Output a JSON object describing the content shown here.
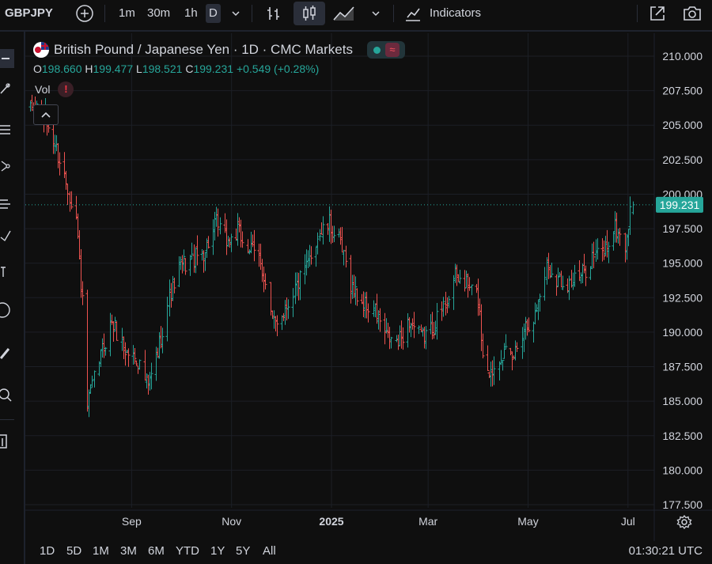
{
  "toolbar": {
    "symbol": "GBPJPY",
    "intervals": [
      "1m",
      "30m",
      "1h",
      "D"
    ],
    "active_interval": "D",
    "indicators_label": "Indicators"
  },
  "legend": {
    "title": "British Pound / Japanese Yen · 1D · CMC Markets",
    "o_label": "O",
    "o_value": "198.660",
    "h_label": "H",
    "h_value": "199.477",
    "l_label": "L",
    "l_value": "198.521",
    "c_label": "C",
    "c_value": "199.231",
    "change": "+0.549 (+0.28%)",
    "vol_label": "Vol",
    "vol_warning": "!"
  },
  "price_axis": {
    "ticks": [
      "210.000",
      "207.500",
      "205.000",
      "202.500",
      "200.000",
      "197.500",
      "195.000",
      "192.500",
      "190.000",
      "187.500",
      "185.000",
      "182.500",
      "180.000",
      "177.500"
    ],
    "last_price": "199.231"
  },
  "time_axis": {
    "labels": [
      "Sep",
      "Nov",
      "2025",
      "Mar",
      "May",
      "Jul"
    ]
  },
  "range_buttons": [
    "1D",
    "5D",
    "1M",
    "3M",
    "6M",
    "YTD",
    "1Y",
    "5Y",
    "All"
  ],
  "clock": "01:30:21 UTC",
  "colors": {
    "up": "#26a69a",
    "down": "#ef5350",
    "background": "#0f0f0f",
    "grid": "#1c1f26",
    "text": "#d1d4dc"
  },
  "chart_data": {
    "type": "ohlc",
    "x_range": [
      "2024-07-01",
      "2025-07-04"
    ],
    "y_range": [
      177.5,
      210.0
    ],
    "y_scale": "linear",
    "grid": true,
    "last_price": 199.231,
    "last_bar": {
      "open": 198.66,
      "high": 199.477,
      "low": 198.521,
      "close": 199.231
    },
    "close_path": [
      {
        "date": "2024-07-01",
        "close": 206.0
      },
      {
        "date": "2024-07-05",
        "close": 206.4
      },
      {
        "date": "2024-07-11",
        "close": 205.2
      },
      {
        "date": "2024-07-16",
        "close": 203.6
      },
      {
        "date": "2024-07-22",
        "close": 201.3
      },
      {
        "date": "2024-07-29",
        "close": 198.3
      },
      {
        "date": "2024-08-02",
        "close": 192.0
      },
      {
        "date": "2024-08-05",
        "close": 184.5
      },
      {
        "date": "2024-08-12",
        "close": 188.0
      },
      {
        "date": "2024-08-20",
        "close": 190.8
      },
      {
        "date": "2024-08-28",
        "close": 188.6
      },
      {
        "date": "2024-09-04",
        "close": 188.2
      },
      {
        "date": "2024-09-11",
        "close": 186.0
      },
      {
        "date": "2024-09-17",
        "close": 188.5
      },
      {
        "date": "2024-09-24",
        "close": 192.6
      },
      {
        "date": "2024-10-01",
        "close": 194.8
      },
      {
        "date": "2024-10-08",
        "close": 195.2
      },
      {
        "date": "2024-10-15",
        "close": 195.8
      },
      {
        "date": "2024-10-23",
        "close": 197.8
      },
      {
        "date": "2024-10-30",
        "close": 196.5
      },
      {
        "date": "2024-11-05",
        "close": 197.2
      },
      {
        "date": "2024-11-12",
        "close": 196.0
      },
      {
        "date": "2024-11-19",
        "close": 195.3
      },
      {
        "date": "2024-11-26",
        "close": 190.6
      },
      {
        "date": "2024-12-03",
        "close": 191.5
      },
      {
        "date": "2024-12-10",
        "close": 193.2
      },
      {
        "date": "2024-12-17",
        "close": 194.6
      },
      {
        "date": "2024-12-24",
        "close": 197.0
      },
      {
        "date": "2024-12-31",
        "close": 197.8
      },
      {
        "date": "2025-01-07",
        "close": 196.2
      },
      {
        "date": "2025-01-14",
        "close": 193.2
      },
      {
        "date": "2025-01-21",
        "close": 192.0
      },
      {
        "date": "2025-01-28",
        "close": 191.5
      },
      {
        "date": "2025-02-04",
        "close": 189.6
      },
      {
        "date": "2025-02-11",
        "close": 189.2
      },
      {
        "date": "2025-02-18",
        "close": 190.8
      },
      {
        "date": "2025-02-25",
        "close": 189.6
      },
      {
        "date": "2025-03-04",
        "close": 190.3
      },
      {
        "date": "2025-03-11",
        "close": 191.8
      },
      {
        "date": "2025-03-18",
        "close": 194.0
      },
      {
        "date": "2025-03-25",
        "close": 193.5
      },
      {
        "date": "2025-04-01",
        "close": 192.5
      },
      {
        "date": "2025-04-04",
        "close": 188.5
      },
      {
        "date": "2025-04-09",
        "close": 187.0
      },
      {
        "date": "2025-04-15",
        "close": 188.6
      },
      {
        "date": "2025-04-22",
        "close": 187.9
      },
      {
        "date": "2025-04-29",
        "close": 190.5
      },
      {
        "date": "2025-05-06",
        "close": 191.2
      },
      {
        "date": "2025-05-13",
        "close": 194.8
      },
      {
        "date": "2025-05-20",
        "close": 193.8
      },
      {
        "date": "2025-05-27",
        "close": 193.6
      },
      {
        "date": "2025-06-03",
        "close": 194.0
      },
      {
        "date": "2025-06-10",
        "close": 195.5
      },
      {
        "date": "2025-06-17",
        "close": 195.8
      },
      {
        "date": "2025-06-24",
        "close": 197.6
      },
      {
        "date": "2025-06-30",
        "close": 196.3
      },
      {
        "date": "2025-07-04",
        "close": 199.231
      }
    ]
  }
}
